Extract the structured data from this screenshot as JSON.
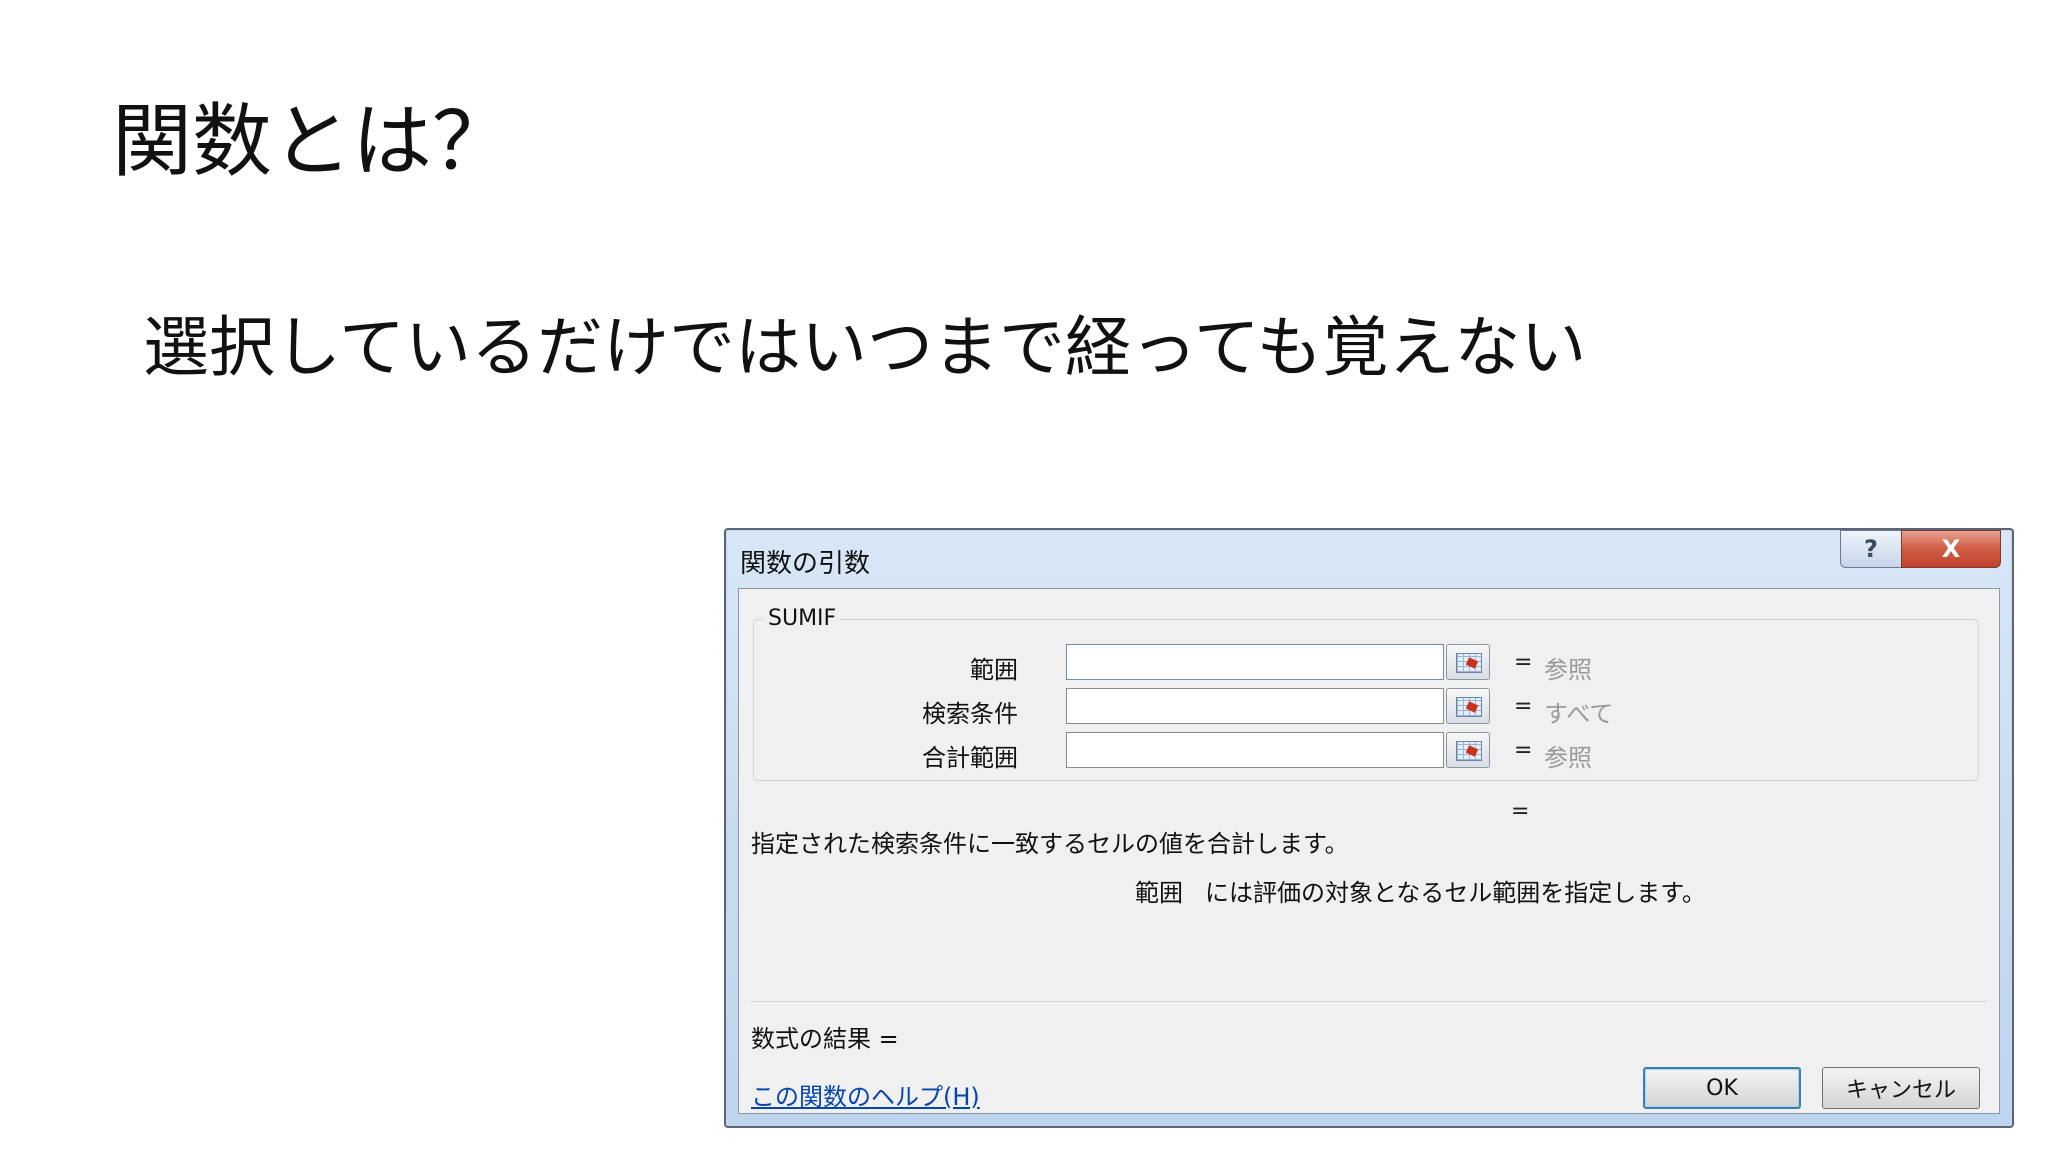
{
  "slide": {
    "title": "関数とは？",
    "subtitle": "選択しているだけではいつまで経っても覚えない"
  },
  "dialog": {
    "title": "関数の引数",
    "help_button": "?",
    "close_button": "X",
    "function_name": "SUMIF",
    "arguments": [
      {
        "label": "範囲",
        "value": "",
        "result_hint": "参照"
      },
      {
        "label": "検索条件",
        "value": "",
        "result_hint": "すべて"
      },
      {
        "label": "合計範囲",
        "value": "",
        "result_hint": "参照"
      }
    ],
    "equals": "=",
    "description": "指定された検索条件に一致するセルの値を合計します。",
    "arg_description_name": "範囲",
    "arg_description_text": "には評価の対象となるセル範囲を指定します。",
    "formula_result_label": "数式の結果 =",
    "help_link": "この関数のヘルプ(H)",
    "ok_label": "OK",
    "cancel_label": "キャンセル"
  },
  "colors": {
    "titlebar": "#c8dcf1",
    "close_button": "#c0432c",
    "client_bg": "#f0f0f0",
    "link": "#0645ad",
    "hint_text": "#9a9a9a"
  },
  "icons": {
    "help": "question-icon",
    "close": "close-icon",
    "reference": "collapse-dialog-icon"
  }
}
